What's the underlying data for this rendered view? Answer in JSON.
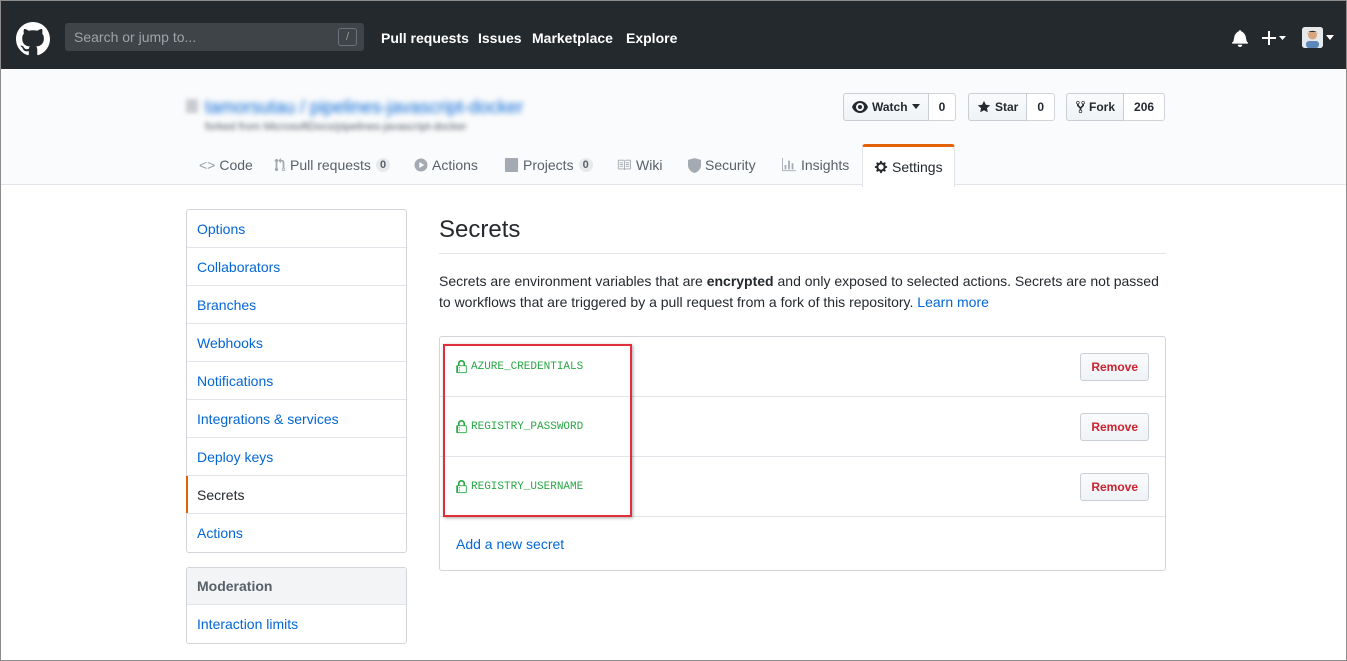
{
  "header": {
    "search_placeholder": "Search or jump to...",
    "search_shortcut": "/",
    "nav": [
      "Pull requests",
      "Issues",
      "Marketplace",
      "Explore"
    ],
    "icons": [
      "github-logo-icon",
      "bell-icon",
      "plus-icon",
      "avatar"
    ]
  },
  "repo": {
    "title": "tamorsutau / pipelines-javascript-docker",
    "subtitle": "forked from MicrosoftDocs/pipelines-javascript-docker",
    "actions": {
      "watch_label": "Watch",
      "watch_count": "0",
      "star_label": "Star",
      "star_count": "0",
      "fork_label": "Fork",
      "fork_count": "206"
    },
    "tabs": {
      "code": "Code",
      "pull_requests": "Pull requests",
      "pull_requests_count": "0",
      "actions": "Actions",
      "projects": "Projects",
      "projects_count": "0",
      "wiki": "Wiki",
      "security": "Security",
      "insights": "Insights",
      "settings": "Settings"
    }
  },
  "sidebar": {
    "items": [
      "Options",
      "Collaborators",
      "Branches",
      "Webhooks",
      "Notifications",
      "Integrations & services",
      "Deploy keys",
      "Secrets",
      "Actions"
    ],
    "selected": "Secrets",
    "moderation_heading": "Moderation",
    "moderation_items": [
      "Interaction limits"
    ]
  },
  "main": {
    "title": "Secrets",
    "desc_part1": "Secrets are environment variables that are ",
    "desc_bold": "encrypted",
    "desc_part2": " and only exposed to selected actions. Secrets are not passed to workflows that are triggered by a pull request from a fork of this repository. ",
    "learn_more": "Learn more",
    "secrets": [
      {
        "name": "AZURE_CREDENTIALS",
        "action": "Remove"
      },
      {
        "name": "REGISTRY_PASSWORD",
        "action": "Remove"
      },
      {
        "name": "REGISTRY_USERNAME",
        "action": "Remove"
      }
    ],
    "add_secret": "Add a new secret"
  },
  "colors": {
    "header_bg": "#24292e",
    "link": "#0366d6",
    "secret_green": "#28a745",
    "remove_red": "#cb2431",
    "selected_accent": "#e36209",
    "highlight_red": "#e02f3b"
  }
}
